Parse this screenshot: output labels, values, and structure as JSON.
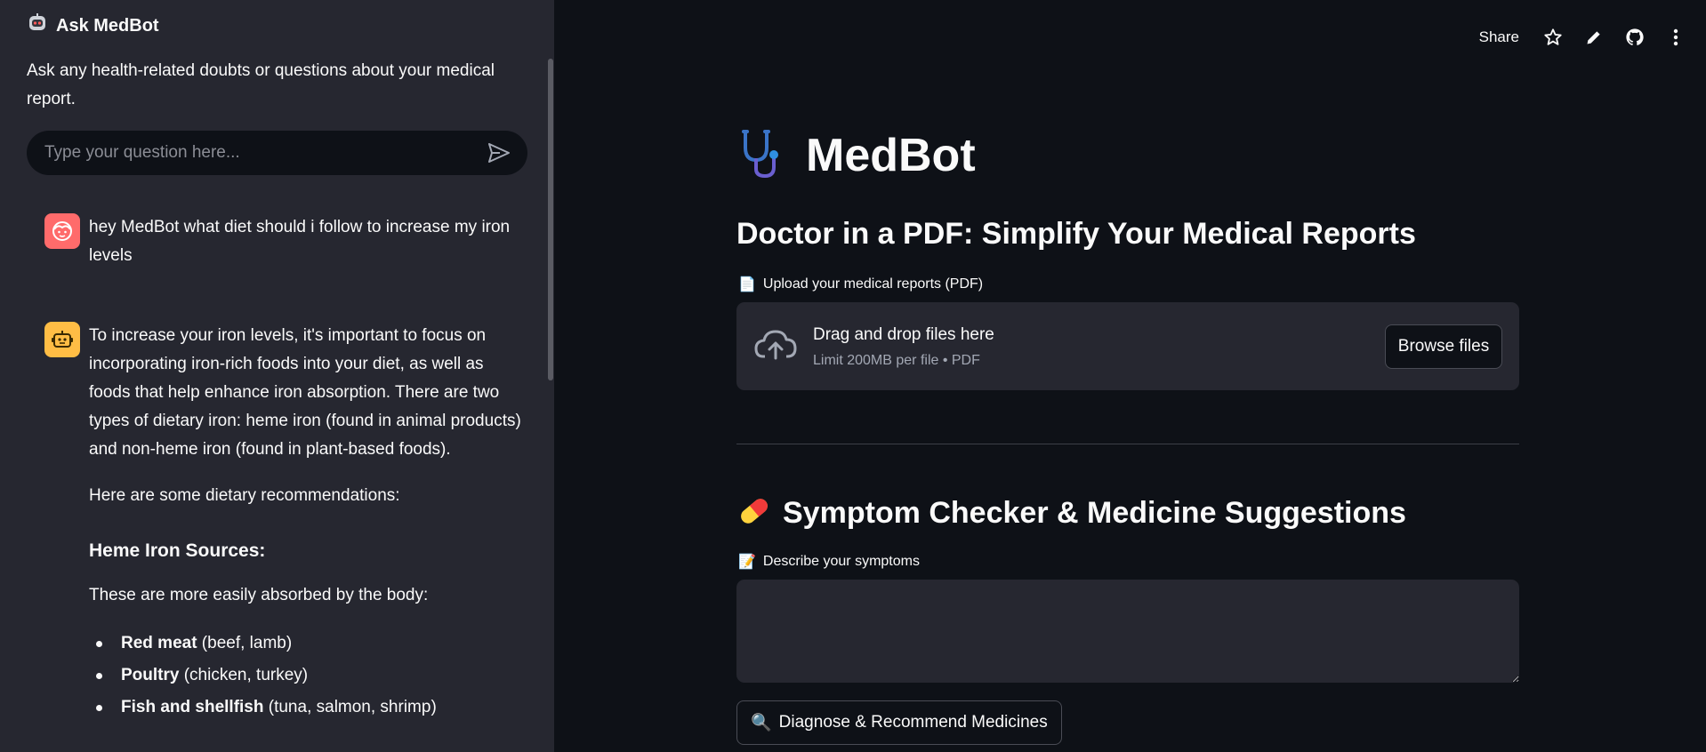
{
  "sidebar": {
    "title": "Ask MedBot",
    "description": "Ask any health-related doubts or questions about your medical report.",
    "input_placeholder": "Type your question here...",
    "messages": {
      "user": {
        "text": "hey MedBot what diet should i follow to increase my iron levels"
      },
      "bot": {
        "intro": "To increase your iron levels, it's important to focus on incorporating iron-rich foods into your diet, as well as foods that help enhance iron absorption. There are two types of dietary iron: heme iron (found in animal products) and non-heme iron (found in plant-based foods).",
        "recommendations": "Here are some dietary recommendations:",
        "heading": "Heme Iron Sources:",
        "heading_note": "These are more easily absorbed by the body:",
        "items": [
          {
            "bold": "Red meat",
            "rest": " (beef, lamb)"
          },
          {
            "bold": "Poultry",
            "rest": " (chicken, turkey)"
          },
          {
            "bold": "Fish and shellfish",
            "rest": " (tuna, salmon, shrimp)"
          }
        ]
      }
    }
  },
  "header": {
    "share_label": "Share",
    "icons": [
      "star-icon",
      "pencil-icon",
      "github-icon",
      "more-vertical-icon"
    ]
  },
  "main": {
    "app_title": "MedBot",
    "subtitle": "Doctor in a PDF: Simplify Your Medical Reports",
    "upload_label": "Upload your medical reports (PDF)",
    "upload_icon": "📄",
    "dropzone_title": "Drag and drop files here",
    "dropzone_limit": "Limit 200MB per file • PDF",
    "browse_label": "Browse files",
    "section_title": "Symptom Checker & Medicine Suggestions",
    "section_icon": "💊",
    "symptoms_label": "Describe your symptoms",
    "symptoms_icon": "📝",
    "symptoms_value": "",
    "diagnose_label": "Diagnose & Recommend Medicines",
    "diagnose_icon": "🔍"
  },
  "colors": {
    "app_bg": "#0e1117",
    "sidebar_bg": "#262730",
    "user_avatar": "#ff6b6b",
    "bot_avatar": "#ffbd45",
    "stethoscope_accent": "#2f8fe0"
  }
}
